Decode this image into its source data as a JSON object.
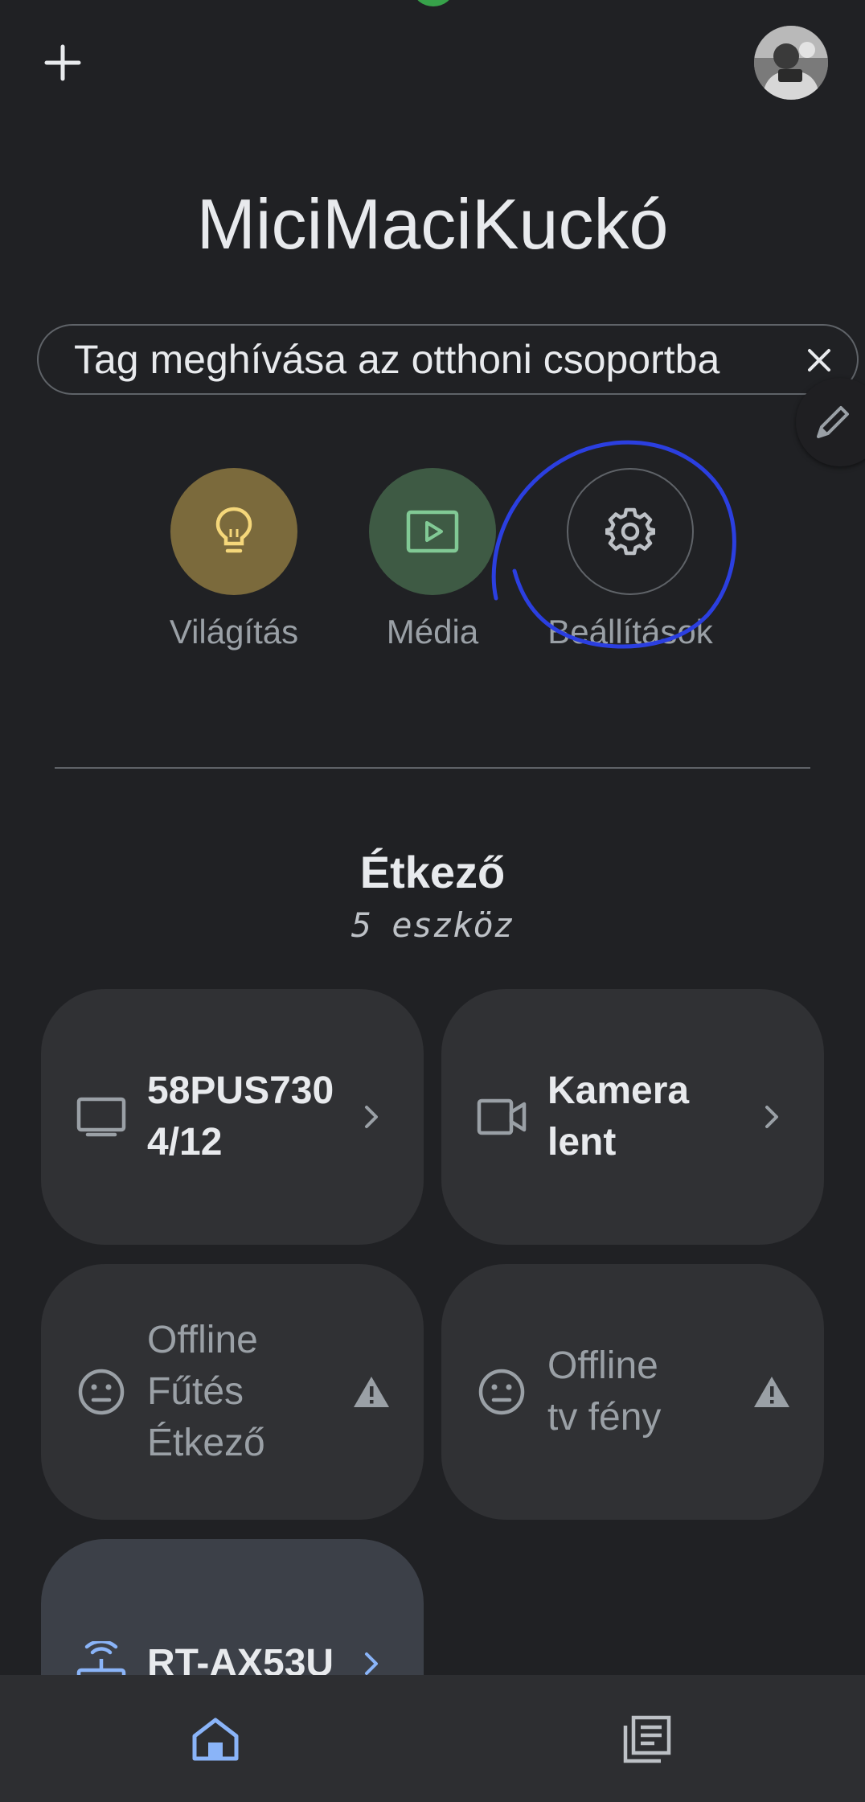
{
  "header": {
    "add_icon": "plus-icon",
    "avatar_icon": "profile-photo"
  },
  "home": {
    "title": "MiciMaciKuckó"
  },
  "invite_chip": {
    "text": "Tag meghívása az otthoni csoportba",
    "close_icon": "close-icon"
  },
  "shortcuts": [
    {
      "label": "Világítás",
      "icon": "lightbulb-icon",
      "color": "#7b6a3c"
    },
    {
      "label": "Média",
      "icon": "media-play-icon",
      "color": "#3e5a44"
    },
    {
      "label": "Beállítások",
      "icon": "gear-icon",
      "color": "#202124"
    }
  ],
  "annotation": {
    "color": "#2b3fe0"
  },
  "room": {
    "name": "Étkező",
    "count": "5 eszköz"
  },
  "devices": [
    {
      "name_line1": "58PUS730",
      "name_line2": "4/12",
      "icon": "tv-icon",
      "state": "online"
    },
    {
      "name_line1": "Kamera",
      "name_line2": "lent",
      "icon": "camera-icon",
      "state": "online"
    },
    {
      "name_line1": "Offline",
      "name_line2": "Fűtés",
      "name_line3": "Étkező",
      "icon": "offline-face-icon",
      "state": "offline"
    },
    {
      "name_line1": "Offline",
      "name_line2": "tv fény",
      "icon": "offline-face-icon",
      "state": "offline"
    },
    {
      "name_line1": "RT-AX53U",
      "icon": "router-icon",
      "state": "online"
    }
  ],
  "bottom_nav": {
    "home_icon": "home-icon",
    "feed_icon": "feed-icon",
    "active_color": "#8ab4f8"
  }
}
